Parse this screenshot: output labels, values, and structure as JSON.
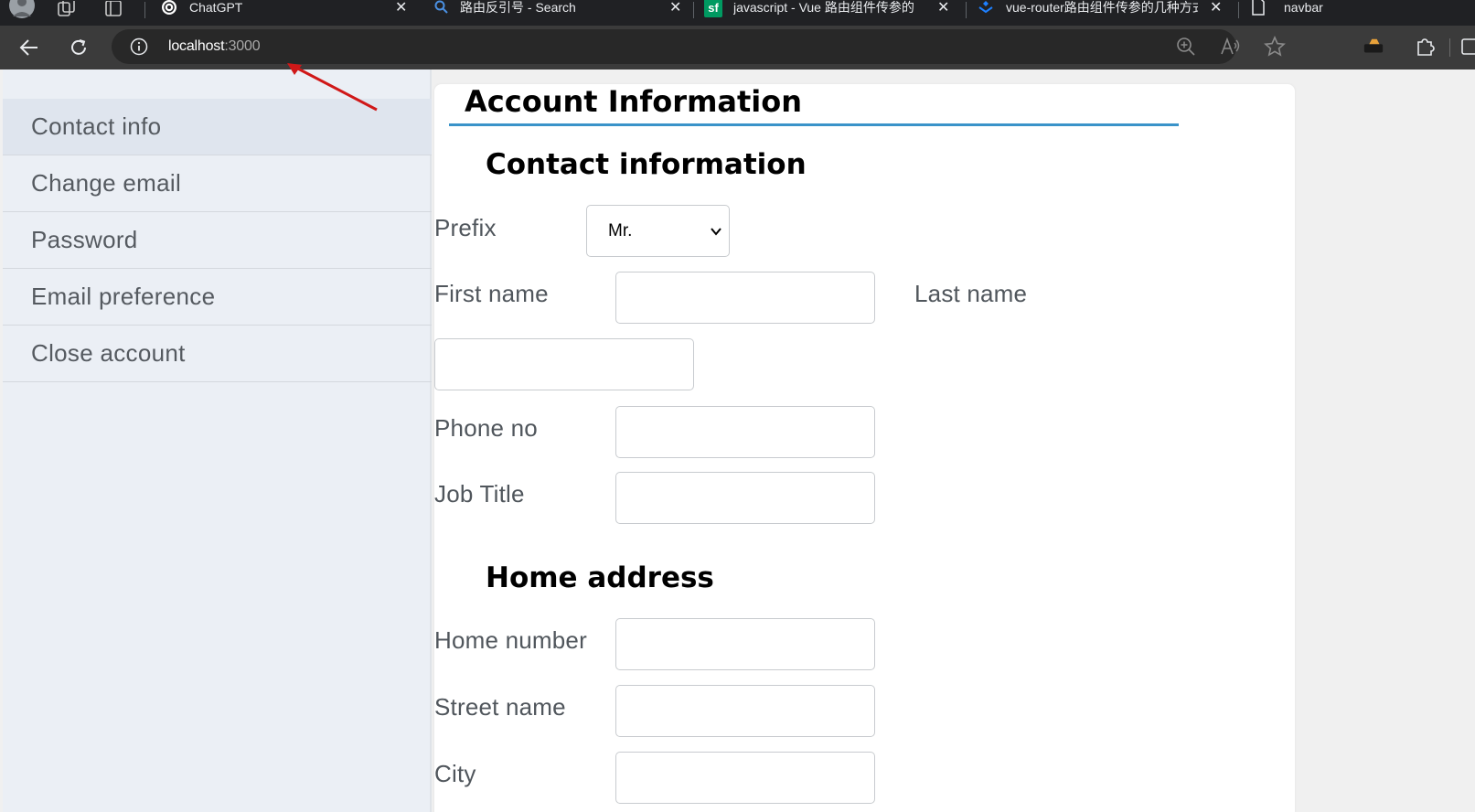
{
  "browser": {
    "tabs": [
      {
        "title": "ChatGPT",
        "favicon": "chatgpt-icon"
      },
      {
        "title": "路由反引号 - Search",
        "favicon": "search-icon"
      },
      {
        "title": "javascript - Vue 路由组件传参的",
        "favicon": "sf-icon"
      },
      {
        "title": "vue-router路由组件传参的几种方式(",
        "favicon": "juejin-icon"
      },
      {
        "title": "navbar",
        "favicon": "page-icon"
      }
    ],
    "close_glyph": "✕",
    "sf_glyph": "sf",
    "url_host": "localhost",
    "url_port": ":3000",
    "accent": "#4a90e2"
  },
  "sidebar": {
    "items": [
      {
        "label": "Contact info",
        "active": true
      },
      {
        "label": "Change email"
      },
      {
        "label": "Password"
      },
      {
        "label": "Email preference"
      },
      {
        "label": "Close account"
      }
    ]
  },
  "content": {
    "title": "Account Information",
    "contact_heading": "Contact information",
    "prefix_label": "Prefix",
    "prefix_value": "Mr.",
    "first_name_label": "First name",
    "last_name_label": "Last name",
    "phone_label": "Phone no",
    "job_title_label": "Job Title",
    "home_heading": "Home address",
    "home_number_label": "Home number",
    "street_name_label": "Street name",
    "city_label": "City",
    "rule_color": "#3a93c9"
  }
}
